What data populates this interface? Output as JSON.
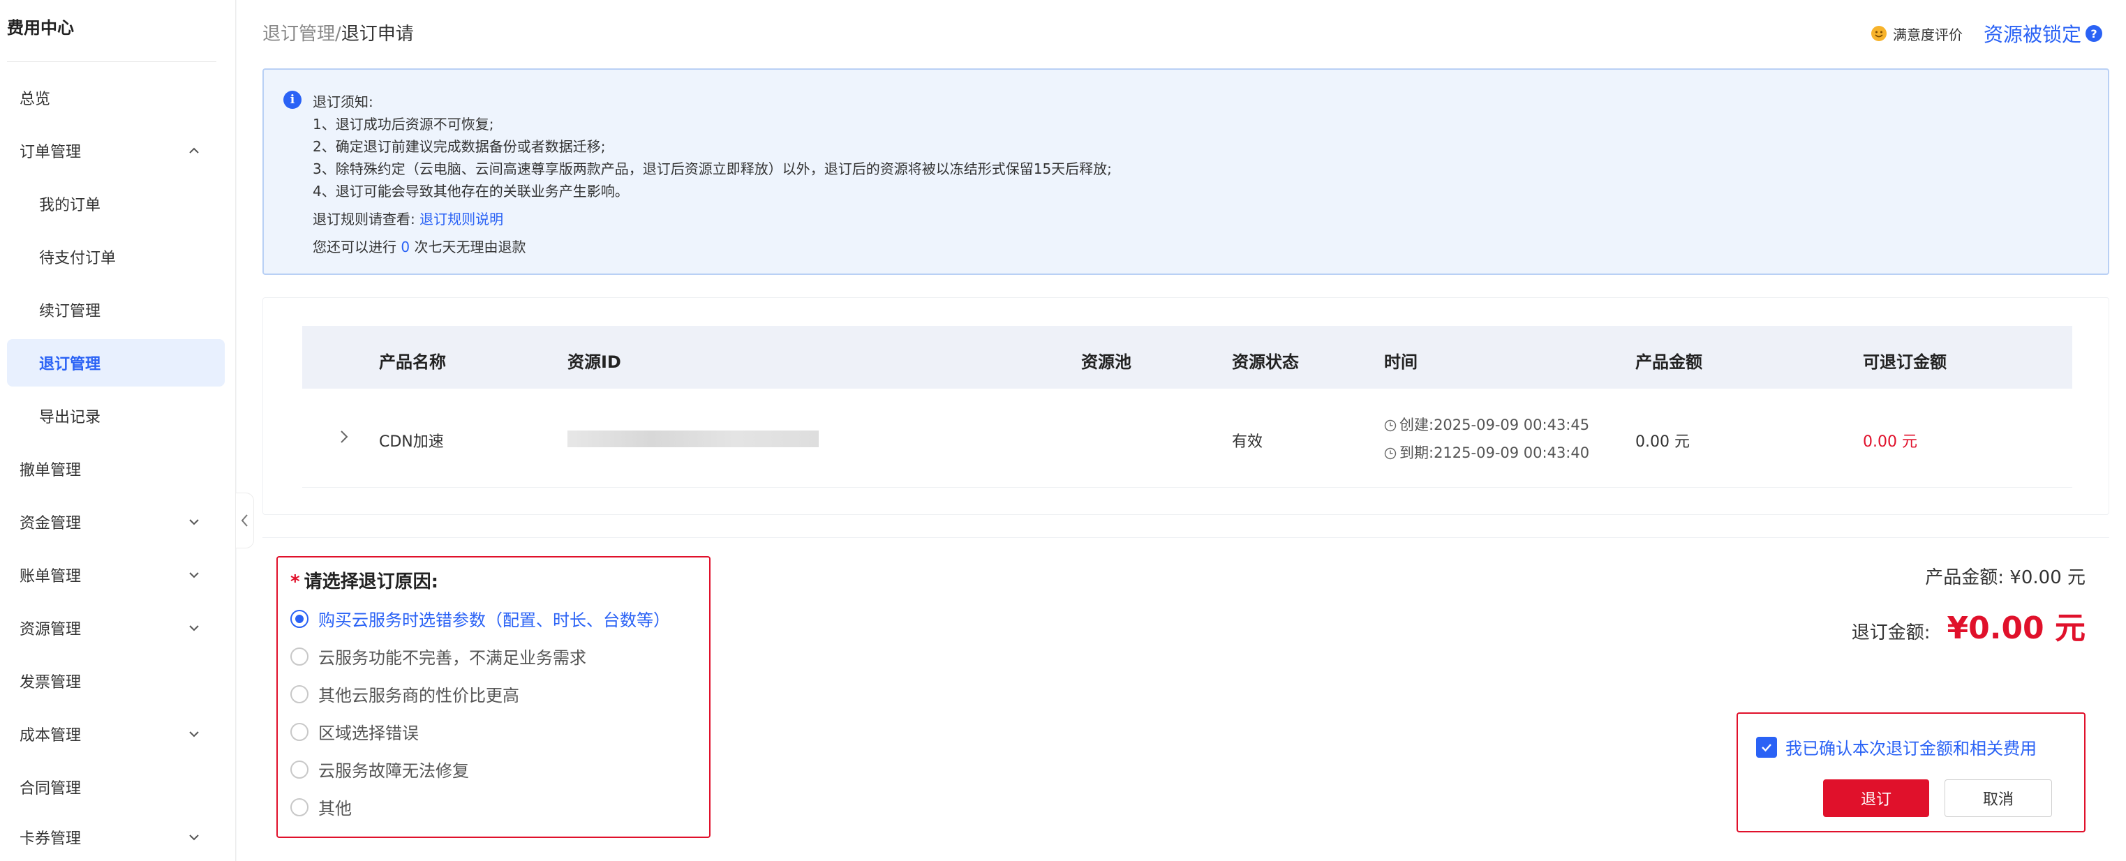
{
  "sidebar": {
    "title": "费用中心",
    "items": [
      {
        "label": "总览"
      },
      {
        "label": "订单管理"
      },
      {
        "label": "我的订单"
      },
      {
        "label": "待支付订单"
      },
      {
        "label": "续订管理"
      },
      {
        "label": "退订管理"
      },
      {
        "label": "导出记录"
      },
      {
        "label": "撤单管理"
      },
      {
        "label": "资金管理"
      },
      {
        "label": "账单管理"
      },
      {
        "label": "资源管理"
      },
      {
        "label": "发票管理"
      },
      {
        "label": "成本管理"
      },
      {
        "label": "合同管理"
      },
      {
        "label": "卡券管理"
      }
    ]
  },
  "breadcrumb": {
    "parent": "退订管理",
    "separator": "/",
    "current": "退订申请"
  },
  "header": {
    "satisfaction": "满意度评价",
    "resource_locked": "资源被锁定",
    "help": "?"
  },
  "notice": {
    "title": "退订须知:",
    "line1": "1、退订成功后资源不可恢复;",
    "line2": "2、确定退订前建议完成数据备份或者数据迁移;",
    "line3": "3、除特殊约定（云电脑、云间高速尊享版两款产品，退订后资源立即释放）以外，退订后的资源将被以冻结形式保留15天后释放;",
    "line4": "4、退订可能会导致其他存在的关联业务产生影响。",
    "rule_prefix": "退订规则请查看:",
    "rule_link": "退订规则说明",
    "count_prefix": "您还可以进行",
    "count": "0",
    "count_suffix": "次七天无理由退款"
  },
  "table": {
    "headers": {
      "product": "产品名称",
      "resource_id": "资源ID",
      "pool": "资源池",
      "status": "资源状态",
      "time": "时间",
      "amount": "产品金额",
      "refundable": "可退订金额"
    },
    "rows": [
      {
        "product": "CDN加速",
        "resource_id": "",
        "pool": "",
        "status": "有效",
        "created": "创建:2025-09-09 00:43:45",
        "expires": "到期:2125-09-09 00:43:40",
        "amount": "0.00 元",
        "refundable": "0.00 元"
      }
    ]
  },
  "reason": {
    "required_mark": "*",
    "title": "请选择退订原因:",
    "options": [
      {
        "label": "购买云服务时选错参数（配置、时长、台数等）",
        "selected": true
      },
      {
        "label": "云服务功能不完善，不满足业务需求",
        "selected": false
      },
      {
        "label": "其他云服务商的性价比更高",
        "selected": false
      },
      {
        "label": "区域选择错误",
        "selected": false
      },
      {
        "label": "云服务故障无法修复",
        "selected": false
      },
      {
        "label": "其他",
        "selected": false
      }
    ]
  },
  "summary": {
    "product_amount_label": "产品金额:",
    "product_amount": "¥0.00 元",
    "refund_label": "退订金额:",
    "refund_amount": "¥0.00 元"
  },
  "confirm": {
    "checkbox_label": "我已确认本次退订金额和相关费用",
    "checked": true,
    "submit": "退订",
    "cancel": "取消"
  },
  "colors": {
    "accent": "#2a62f5",
    "danger": "#e0112b",
    "notice_bg": "#eef4fd"
  }
}
